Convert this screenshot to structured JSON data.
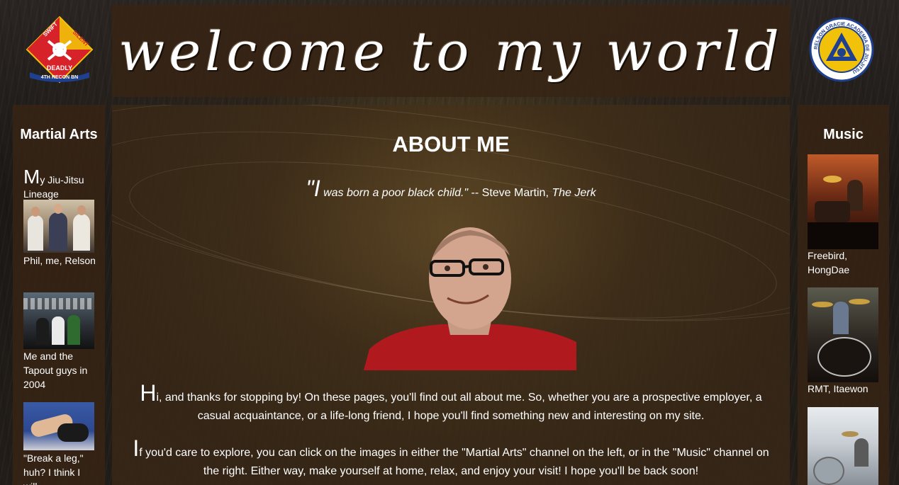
{
  "header": {
    "title": "welcome to my world",
    "left_logo": {
      "icon": "recon-battalion-emblem-icon",
      "text_top_left": "SWIFT",
      "text_top_right": "SILENT",
      "text_mid": "DEADLY",
      "text_bottom": "4TH RECON BN"
    },
    "right_logo": {
      "icon": "relson-gracie-academy-emblem-icon",
      "text": "RELSON GRACIE ACADEMIA DE JIU-JITSU"
    }
  },
  "left_sidebar": {
    "heading": "Martial Arts",
    "intro_cap": "M",
    "intro_rest": "y Jiu-Jitsu Lineage",
    "items": [
      {
        "caption": "Phil, me, Relson",
        "image": "jiu-jitsu-lineage-photo"
      },
      {
        "caption": "Me and the Tapout guys in 2004",
        "image": "tapout-photo"
      },
      {
        "caption": "\"Break a leg,\" huh? I think I will...",
        "image": "grappling-photo"
      }
    ]
  },
  "right_sidebar": {
    "heading": "Music",
    "items": [
      {
        "caption": "Freebird, HongDae",
        "image": "drummer-photo-1"
      },
      {
        "caption": "RMT, Itaewon",
        "image": "drummer-photo-2"
      },
      {
        "caption": "",
        "image": "drummer-photo-3"
      }
    ]
  },
  "main": {
    "title": "ABOUT ME",
    "quote_open": "\"I",
    "quote_text": " was born a poor black child.\"",
    "quote_attribution": " -- Steve Martin, ",
    "quote_source": "The Jerk",
    "portrait": "portrait-photo",
    "paragraphs": [
      {
        "cap": "H",
        "text": "i, and thanks for stopping by! On these pages, you'll find out all about me. So, whether you are a prospective employer, a casual acquaintance, or a life-long friend, I hope you'll find something new and interesting on my site."
      },
      {
        "cap": "I",
        "text": "f you'd care to explore, you can click on the images in either the \"Martial Arts\" channel on the left, or in the \"Music\" channel on the right. Either way, make yourself at home, relax, and enjoy your visit! I hope you'll be back soon!"
      }
    ]
  },
  "colors": {
    "panel": "#37241a",
    "text": "#ffffff",
    "logo_red": "#d8222a",
    "logo_yellow": "#f2c20a",
    "logo_blue": "#1f3f8f"
  }
}
